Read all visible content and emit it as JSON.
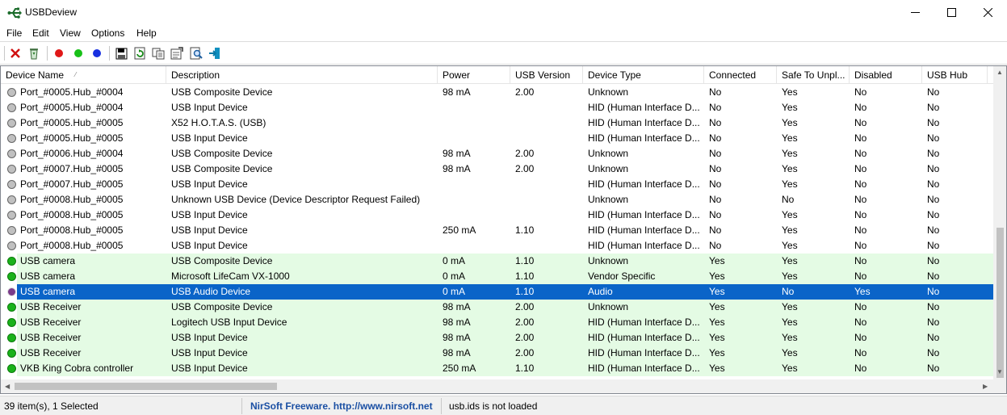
{
  "window": {
    "title": "USBDeview",
    "minimize_glyph": "—",
    "maximize_glyph": "☐",
    "close_glyph": "✕"
  },
  "menu": [
    "File",
    "Edit",
    "View",
    "Options",
    "Help"
  ],
  "toolbar": {
    "buttons": [
      {
        "name": "uninstall-icon",
        "glyph": "✕",
        "color": "#d01010"
      },
      {
        "name": "recycle-icon",
        "glyph": "♻",
        "color": "#3a7a3a"
      },
      {
        "name": "red-dot-icon",
        "color": "#e01818"
      },
      {
        "name": "green-dot-icon",
        "color": "#18c018"
      },
      {
        "name": "blue-dot-icon",
        "color": "#1830e0"
      },
      {
        "name": "save-icon",
        "glyph": "💾",
        "color": "#204080"
      },
      {
        "name": "refresh-icon",
        "glyph": "⟳",
        "color": "#208020"
      },
      {
        "name": "copy-icon",
        "glyph": "⎘",
        "color": "#404040"
      },
      {
        "name": "properties-icon",
        "glyph": "☷",
        "color": "#404040"
      },
      {
        "name": "html-report-icon",
        "glyph": "⌕",
        "color": "#2060a0"
      },
      {
        "name": "exit-icon",
        "glyph": "⇥",
        "color": "#1090c0"
      }
    ]
  },
  "columns": [
    "Device Name",
    "Description",
    "Power",
    "USB Version",
    "Device Type",
    "Connected",
    "Safe To Unpl...",
    "Disabled",
    "USB Hub"
  ],
  "sort_indicator": "⁄",
  "rows": [
    {
      "dot": "gray",
      "style": "",
      "cells": [
        "Port_#0005.Hub_#0004",
        "USB Composite Device",
        "98 mA",
        "2.00",
        "Unknown",
        "No",
        "Yes",
        "No",
        "No"
      ]
    },
    {
      "dot": "gray",
      "style": "",
      "cells": [
        "Port_#0005.Hub_#0004",
        "USB Input Device",
        "",
        "",
        "HID (Human Interface D...",
        "No",
        "Yes",
        "No",
        "No"
      ]
    },
    {
      "dot": "gray",
      "style": "",
      "cells": [
        "Port_#0005.Hub_#0005",
        "X52 H.O.T.A.S. (USB)",
        "",
        "",
        "HID (Human Interface D...",
        "No",
        "Yes",
        "No",
        "No"
      ]
    },
    {
      "dot": "gray",
      "style": "",
      "cells": [
        "Port_#0005.Hub_#0005",
        "USB Input Device",
        "",
        "",
        "HID (Human Interface D...",
        "No",
        "Yes",
        "No",
        "No"
      ]
    },
    {
      "dot": "gray",
      "style": "",
      "cells": [
        "Port_#0006.Hub_#0004",
        "USB Composite Device",
        "98 mA",
        "2.00",
        "Unknown",
        "No",
        "Yes",
        "No",
        "No"
      ]
    },
    {
      "dot": "gray",
      "style": "",
      "cells": [
        "Port_#0007.Hub_#0005",
        "USB Composite Device",
        "98 mA",
        "2.00",
        "Unknown",
        "No",
        "Yes",
        "No",
        "No"
      ]
    },
    {
      "dot": "gray",
      "style": "",
      "cells": [
        "Port_#0007.Hub_#0005",
        "USB Input Device",
        "",
        "",
        "HID (Human Interface D...",
        "No",
        "Yes",
        "No",
        "No"
      ]
    },
    {
      "dot": "gray",
      "style": "",
      "cells": [
        "Port_#0008.Hub_#0005",
        "Unknown USB Device (Device Descriptor Request Failed)",
        "",
        "",
        "Unknown",
        "No",
        "No",
        "No",
        "No"
      ]
    },
    {
      "dot": "gray",
      "style": "",
      "cells": [
        "Port_#0008.Hub_#0005",
        "USB Input Device",
        "",
        "",
        "HID (Human Interface D...",
        "No",
        "Yes",
        "No",
        "No"
      ]
    },
    {
      "dot": "gray",
      "style": "",
      "cells": [
        "Port_#0008.Hub_#0005",
        "USB Input Device",
        "250 mA",
        "1.10",
        "HID (Human Interface D...",
        "No",
        "Yes",
        "No",
        "No"
      ]
    },
    {
      "dot": "gray",
      "style": "",
      "cells": [
        "Port_#0008.Hub_#0005",
        "USB Input Device",
        "",
        "",
        "HID (Human Interface D...",
        "No",
        "Yes",
        "No",
        "No"
      ]
    },
    {
      "dot": "green",
      "style": "green",
      "cells": [
        "USB camera",
        "USB Composite Device",
        "0 mA",
        "1.10",
        "Unknown",
        "Yes",
        "Yes",
        "No",
        "No"
      ]
    },
    {
      "dot": "green",
      "style": "green",
      "cells": [
        "USB camera",
        "Microsoft LifeCam VX-1000",
        "0 mA",
        "1.10",
        "Vendor Specific",
        "Yes",
        "Yes",
        "No",
        "No"
      ]
    },
    {
      "dot": "purple",
      "style": "selected",
      "cells": [
        "USB camera",
        "USB Audio Device",
        "0 mA",
        "1.10",
        "Audio",
        "Yes",
        "No",
        "Yes",
        "No"
      ]
    },
    {
      "dot": "green",
      "style": "green",
      "cells": [
        "USB Receiver",
        "USB Composite Device",
        "98 mA",
        "2.00",
        "Unknown",
        "Yes",
        "Yes",
        "No",
        "No"
      ]
    },
    {
      "dot": "green",
      "style": "green",
      "cells": [
        "USB Receiver",
        "Logitech USB Input Device",
        "98 mA",
        "2.00",
        "HID (Human Interface D...",
        "Yes",
        "Yes",
        "No",
        "No"
      ]
    },
    {
      "dot": "green",
      "style": "green",
      "cells": [
        "USB Receiver",
        "USB Input Device",
        "98 mA",
        "2.00",
        "HID (Human Interface D...",
        "Yes",
        "Yes",
        "No",
        "No"
      ]
    },
    {
      "dot": "green",
      "style": "green",
      "cells": [
        "USB Receiver",
        "USB Input Device",
        "98 mA",
        "2.00",
        "HID (Human Interface D...",
        "Yes",
        "Yes",
        "No",
        "No"
      ]
    },
    {
      "dot": "green",
      "style": "green",
      "cells": [
        "VKB King Cobra controller",
        "USB Input Device",
        "250 mA",
        "1.10",
        "HID (Human Interface D...",
        "Yes",
        "Yes",
        "No",
        "No"
      ]
    }
  ],
  "scrollbar": {
    "up": "▲",
    "down": "▼",
    "left": "◀",
    "right": "▶"
  },
  "statusbar": {
    "count": "39 item(s), 1 Selected",
    "link": "NirSoft Freeware.  http://www.nirsoft.net",
    "usbids": "usb.ids is not loaded"
  },
  "colors": {
    "connected_row_bg": "#e4fbe4",
    "selected_row_bg": "#0a64c8"
  }
}
